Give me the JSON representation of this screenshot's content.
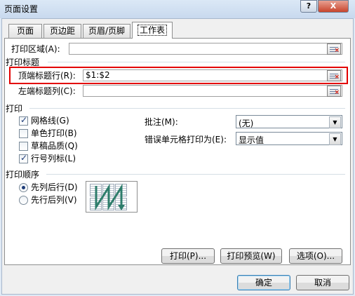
{
  "window": {
    "title": "页面设置",
    "help_label": "?",
    "close_label": "X"
  },
  "tabs": [
    {
      "label": "页面"
    },
    {
      "label": "页边距"
    },
    {
      "label": "页眉/页脚"
    },
    {
      "label": "工作表"
    }
  ],
  "print_area": {
    "label": "打印区域(A):",
    "value": ""
  },
  "print_titles": {
    "group": "打印标题",
    "rows_label": "顶端标题行(R):",
    "rows_value": "$1:$2",
    "cols_label": "左端标题列(C):",
    "cols_value": ""
  },
  "print": {
    "group": "打印",
    "gridlines": {
      "label": "网格线(G)",
      "checked": true
    },
    "black_white": {
      "label": "单色打印(B)",
      "checked": false
    },
    "draft": {
      "label": "草稿品质(Q)",
      "checked": false
    },
    "row_col_headings": {
      "label": "行号列标(L)",
      "checked": true
    },
    "comments_label": "批注(M):",
    "comments_value": "(无)",
    "errors_label": "错误单元格打印为(E):",
    "errors_value": "显示值"
  },
  "page_order": {
    "group": "打印顺序",
    "down_then_over": {
      "label": "先列后行(D)",
      "selected": true
    },
    "over_then_down": {
      "label": "先行后列(V)",
      "selected": false
    }
  },
  "buttons": {
    "print": "打印(P)...",
    "preview": "打印预览(W)",
    "options": "选项(O)...",
    "ok": "确定",
    "cancel": "取消"
  },
  "icons": {
    "ref_button": "collapse-dialog-icon",
    "order_diagram": "page-order-diagram"
  },
  "colors": {
    "highlight": "#e30000",
    "accent": "#1e3c78"
  }
}
